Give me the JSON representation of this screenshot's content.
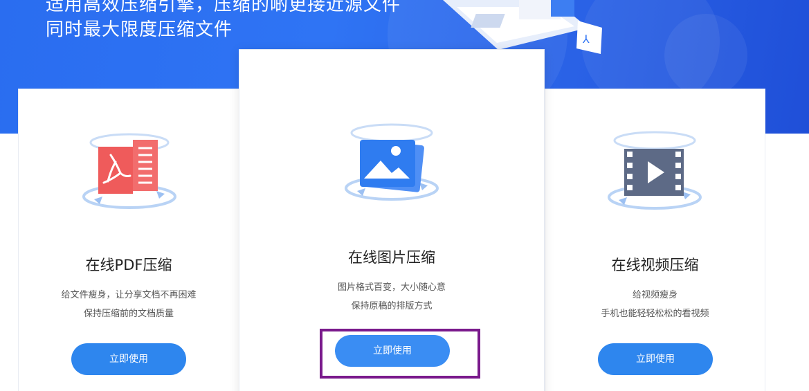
{
  "hero": {
    "line1": "适用高效压缩引擎，压缩的啲更接近源文件",
    "line2": "同时最大限度压缩文件"
  },
  "cards": [
    {
      "title": "在线PDF压缩",
      "desc1": "给文件瘦身，让分享文档不再困难",
      "desc2": "保持压缩前的文档质量",
      "button": "立即使用",
      "icon": "pdf-icon"
    },
    {
      "title": "在线图片压缩",
      "desc1": "图片格式百变，大小随心意",
      "desc2": "保持原稿的排版方式",
      "button": "立即使用",
      "icon": "image-icon"
    },
    {
      "title": "在线视频压缩",
      "desc1": "给视频瘦身",
      "desc2": "手机也能轻轻松松的看视频",
      "button": "立即使用",
      "icon": "video-icon"
    }
  ],
  "colors": {
    "hero_blue": "#2f74f4",
    "button_blue": "#2e86ee",
    "highlight_purple": "#7a1a8c",
    "pdf_red": "#ef5b5b",
    "image_blue": "#2f7cf0",
    "video_slate": "#5d6a86"
  }
}
